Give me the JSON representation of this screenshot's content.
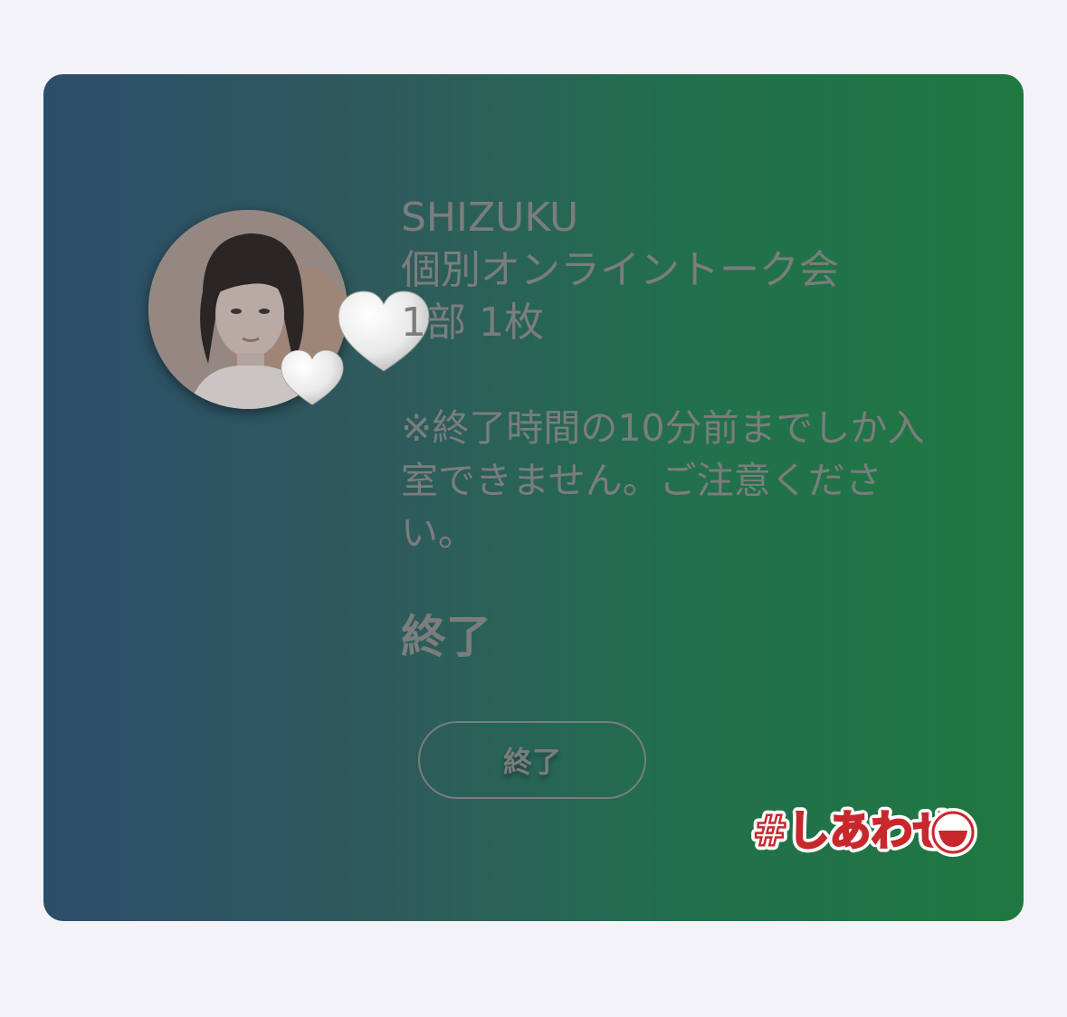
{
  "ticket": {
    "artist": "SHIZUKU",
    "event": "個別オンライントーク会",
    "part": "1部 1枚",
    "notice": "※終了時間の10分前までしか入室できません。ご注意ください。",
    "status": "終了"
  },
  "button": {
    "label": "終了"
  },
  "sticker": {
    "text": "#しあわせ"
  },
  "colors": {
    "page_background": "#f2f2f7",
    "card_gradient_start": "#2d4e6a",
    "card_gradient_end": "#1f7840",
    "text_gray": "#7b7d7d",
    "sticker_red": "#c8282c"
  },
  "icons": [
    "heart-icon",
    "smiley-icon"
  ]
}
